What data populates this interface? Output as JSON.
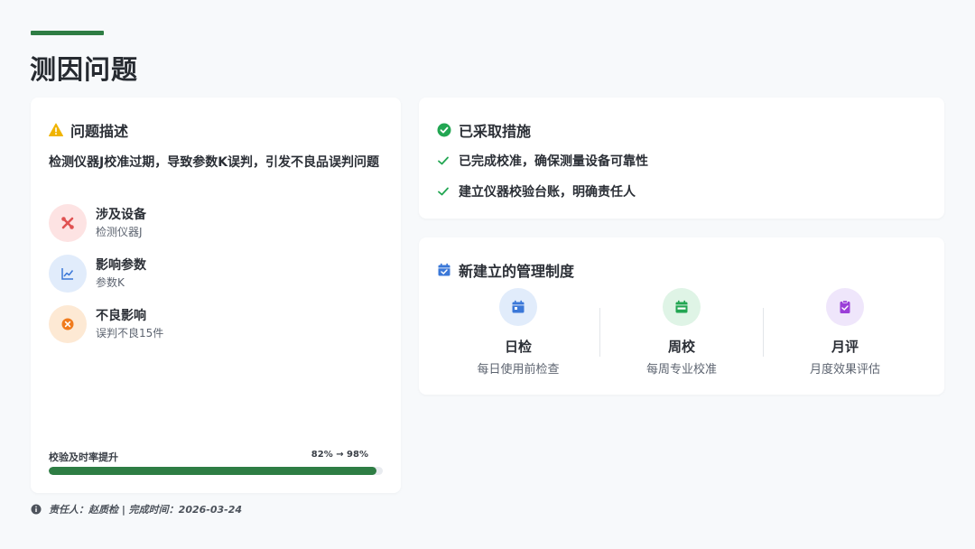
{
  "page": {
    "title": "测因问题"
  },
  "problem": {
    "header": "问题描述",
    "description": "检测仪器J校准过期，导致参数K误判，引发不良品误判问题",
    "items": [
      {
        "title": "涉及设备",
        "value": "检测仪器J",
        "icon": "tools-icon",
        "color": "#e05252"
      },
      {
        "title": "影响参数",
        "value": "参数K",
        "icon": "chart-line-icon",
        "color": "#3b78d8"
      },
      {
        "title": "不良影响",
        "value": "误判不良15件",
        "icon": "x-circle-icon",
        "color": "#f07b1d"
      }
    ],
    "progress": {
      "label": "校验及时率提升",
      "value_text": "82% → 98%",
      "fraction": 0.98
    }
  },
  "measures": {
    "header": "已采取措施",
    "items": [
      "已完成校准，确保测量设备可靠性",
      "建立仪器校验台账，明确责任人"
    ]
  },
  "system": {
    "header": "新建立的管理制度",
    "items": [
      {
        "title": "日检",
        "desc": "每日使用前检查",
        "icon": "calendar-day-icon",
        "color": "#3b78d8"
      },
      {
        "title": "周校",
        "desc": "每周专业校准",
        "icon": "calendar-week-icon",
        "color": "#22a652"
      },
      {
        "title": "月评",
        "desc": "月度效果评估",
        "icon": "clipboard-check-icon",
        "color": "#9b3fd8"
      }
    ]
  },
  "footer": {
    "text": "责任人：赵质检 | 完成时间：2026-03-24"
  },
  "colors": {
    "accent": "#2e7d44",
    "warning": "#f0b400",
    "success": "#22a652",
    "calendar": "#3b78d8"
  }
}
